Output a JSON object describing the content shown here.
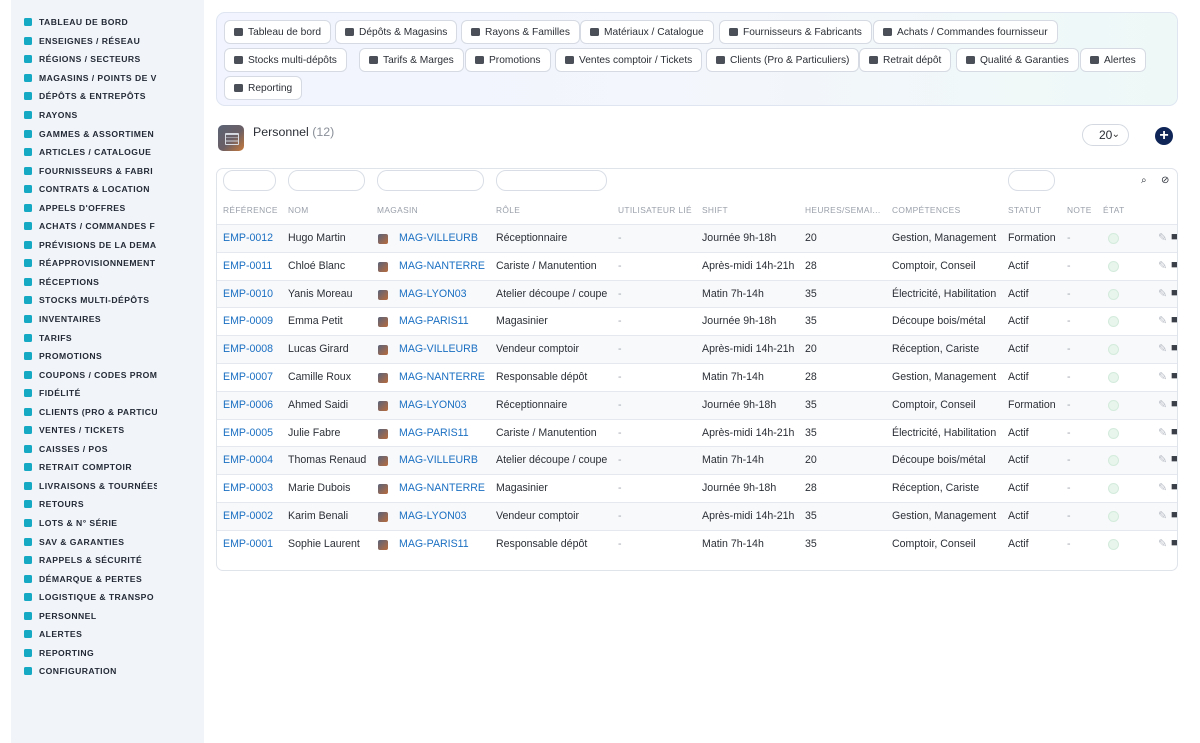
{
  "sidebar": {
    "items": [
      {
        "icon": "dashboard-icon",
        "label": "TABLEAU DE BORD"
      },
      {
        "icon": "flag-icon",
        "label": "ENSEIGNES / RÉSEAU"
      },
      {
        "icon": "map-icon",
        "label": "RÉGIONS / SECTEURS"
      },
      {
        "icon": "store-icon",
        "label": "MAGASINS / POINTS DE V"
      },
      {
        "icon": "warehouse-icon",
        "label": "DÉPÔTS & ENTREPÔTS"
      },
      {
        "icon": "shelf-icon",
        "label": "RAYONS"
      },
      {
        "icon": "layers-icon",
        "label": "GAMMES & ASSORTIMEN"
      },
      {
        "icon": "box-icon",
        "label": "ARTICLES / CATALOGUE"
      },
      {
        "icon": "truck-icon",
        "label": "FOURNISSEURS & FABRI"
      },
      {
        "icon": "contract-icon",
        "label": "CONTRATS & LOCATION"
      },
      {
        "icon": "gavel-icon",
        "label": "APPELS D'OFFRES"
      },
      {
        "icon": "cart-icon",
        "label": "ACHATS / COMMANDES F"
      },
      {
        "icon": "chart-icon",
        "label": "PRÉVISIONS DE LA DEMA"
      },
      {
        "icon": "refresh-icon",
        "label": "RÉAPPROVISIONNEMENT"
      },
      {
        "icon": "receive-icon",
        "label": "RÉCEPTIONS"
      },
      {
        "icon": "stock-icon",
        "label": "STOCKS MULTI-DÉPÔTS"
      },
      {
        "icon": "clipboard-icon",
        "label": "INVENTAIRES"
      },
      {
        "icon": "tag-icon",
        "label": "TARIFS"
      },
      {
        "icon": "percent-icon",
        "label": "PROMOTIONS"
      },
      {
        "icon": "coupon-icon",
        "label": "COUPONS / CODES PROM"
      },
      {
        "icon": "star-icon",
        "label": "FIDÉLITÉ"
      },
      {
        "icon": "user-icon",
        "label": "CLIENTS (PRO & PARTICU"
      },
      {
        "icon": "receipt-icon",
        "label": "VENTES / TICKETS"
      },
      {
        "icon": "register-icon",
        "label": "CAISSES / POS"
      },
      {
        "icon": "car-icon",
        "label": "RETRAIT COMPTOIR"
      },
      {
        "icon": "delivery-icon",
        "label": "LIVRAISONS & TOURNÉES"
      },
      {
        "icon": "return-icon",
        "label": "RETOURS"
      },
      {
        "icon": "barcode-icon",
        "label": "LOTS & N° SÉRIE"
      },
      {
        "icon": "tools-icon",
        "label": "SAV & GARANTIES"
      },
      {
        "icon": "warning-icon",
        "label": "RAPPELS & SÉCURITÉ"
      },
      {
        "icon": "trash-icon",
        "label": "DÉMARQUE & PERTES"
      },
      {
        "icon": "route-icon",
        "label": "LOGISTIQUE & TRANSPO"
      },
      {
        "icon": "people-icon",
        "label": "PERSONNEL"
      },
      {
        "icon": "bell-icon",
        "label": "ALERTES"
      },
      {
        "icon": "pie-icon",
        "label": "REPORTING"
      },
      {
        "icon": "gear-icon",
        "label": "CONFIGURATION"
      }
    ]
  },
  "nav": {
    "buttons": [
      {
        "icon": "dashboard-icon",
        "label": "Tableau de bord"
      },
      {
        "icon": "warehouse-icon",
        "label": "Dépôts & Magasins"
      },
      {
        "icon": "basket-icon",
        "label": "Rayons & Familles"
      },
      {
        "icon": "catalog-icon",
        "label": "Matériaux / Catalogue"
      },
      {
        "icon": "truck-icon",
        "label": "Fournisseurs & Fabricants"
      },
      {
        "icon": "cart-icon",
        "label": "Achats / Commandes fournisseur"
      },
      {
        "icon": "stock-icon",
        "label": "Stocks multi-dépôts"
      },
      {
        "icon": "tag-icon",
        "label": "Tarifs & Marges"
      },
      {
        "icon": "percent-icon",
        "label": "Promotions"
      },
      {
        "icon": "receipt-icon",
        "label": "Ventes comptoir / Tickets"
      },
      {
        "icon": "user-icon",
        "label": "Clients (Pro & Particuliers)"
      },
      {
        "icon": "car-icon",
        "label": "Retrait dépôt"
      },
      {
        "icon": "check-icon",
        "label": "Qualité & Garanties"
      },
      {
        "icon": "bell-icon",
        "label": "Alertes"
      },
      {
        "icon": "pie-icon",
        "label": "Reporting"
      }
    ]
  },
  "header": {
    "title": "Personnel",
    "count": "(12)",
    "page_size": "20"
  },
  "table": {
    "columns": [
      "RÉFÉRENCE",
      "NOM",
      "MAGASIN",
      "RÔLE",
      "UTILISATEUR LIÉ",
      "SHIFT",
      "HEURES/SEMAI...",
      "COMPÉTENCES",
      "STATUT",
      "NOTE",
      "ÉTAT"
    ],
    "rows": [
      {
        "ref": "EMP-0012",
        "nom": "Hugo Martin",
        "magasin": "MAG-VILLEURB",
        "role": "Réceptionnaire",
        "user": "-",
        "shift": "Journée 9h-18h",
        "heures": "20",
        "competences": "Gestion, Management",
        "statut": "Formation",
        "note": "-"
      },
      {
        "ref": "EMP-0011",
        "nom": "Chloé Blanc",
        "magasin": "MAG-NANTERRE",
        "role": "Cariste / Manutention",
        "user": "-",
        "shift": "Après-midi 14h-21h",
        "heures": "28",
        "competences": "Comptoir, Conseil",
        "statut": "Actif",
        "note": "-"
      },
      {
        "ref": "EMP-0010",
        "nom": "Yanis Moreau",
        "magasin": "MAG-LYON03",
        "role": "Atelier découpe / coupe",
        "user": "-",
        "shift": "Matin 7h-14h",
        "heures": "35",
        "competences": "Électricité, Habilitation",
        "statut": "Actif",
        "note": "-"
      },
      {
        "ref": "EMP-0009",
        "nom": "Emma Petit",
        "magasin": "MAG-PARIS11",
        "role": "Magasinier",
        "user": "-",
        "shift": "Journée 9h-18h",
        "heures": "35",
        "competences": "Découpe bois/métal",
        "statut": "Actif",
        "note": "-"
      },
      {
        "ref": "EMP-0008",
        "nom": "Lucas Girard",
        "magasin": "MAG-VILLEURB",
        "role": "Vendeur comptoir",
        "user": "-",
        "shift": "Après-midi 14h-21h",
        "heures": "20",
        "competences": "Réception, Cariste",
        "statut": "Actif",
        "note": "-"
      },
      {
        "ref": "EMP-0007",
        "nom": "Camille Roux",
        "magasin": "MAG-NANTERRE",
        "role": "Responsable dépôt",
        "user": "-",
        "shift": "Matin 7h-14h",
        "heures": "28",
        "competences": "Gestion, Management",
        "statut": "Actif",
        "note": "-"
      },
      {
        "ref": "EMP-0006",
        "nom": "Ahmed Saidi",
        "magasin": "MAG-LYON03",
        "role": "Réceptionnaire",
        "user": "-",
        "shift": "Journée 9h-18h",
        "heures": "35",
        "competences": "Comptoir, Conseil",
        "statut": "Formation",
        "note": "-"
      },
      {
        "ref": "EMP-0005",
        "nom": "Julie Fabre",
        "magasin": "MAG-PARIS11",
        "role": "Cariste / Manutention",
        "user": "-",
        "shift": "Après-midi 14h-21h",
        "heures": "35",
        "competences": "Électricité, Habilitation",
        "statut": "Actif",
        "note": "-"
      },
      {
        "ref": "EMP-0004",
        "nom": "Thomas Renaud",
        "magasin": "MAG-VILLEURB",
        "role": "Atelier découpe / coupe",
        "user": "-",
        "shift": "Matin 7h-14h",
        "heures": "20",
        "competences": "Découpe bois/métal",
        "statut": "Actif",
        "note": "-"
      },
      {
        "ref": "EMP-0003",
        "nom": "Marie Dubois",
        "magasin": "MAG-NANTERRE",
        "role": "Magasinier",
        "user": "-",
        "shift": "Journée 9h-18h",
        "heures": "28",
        "competences": "Réception, Cariste",
        "statut": "Actif",
        "note": "-"
      },
      {
        "ref": "EMP-0002",
        "nom": "Karim Benali",
        "magasin": "MAG-LYON03",
        "role": "Vendeur comptoir",
        "user": "-",
        "shift": "Après-midi 14h-21h",
        "heures": "35",
        "competences": "Gestion, Management",
        "statut": "Actif",
        "note": "-"
      },
      {
        "ref": "EMP-0001",
        "nom": "Sophie Laurent",
        "magasin": "MAG-PARIS11",
        "role": "Responsable dépôt",
        "user": "-",
        "shift": "Matin 7h-14h",
        "heures": "35",
        "competences": "Comptoir, Conseil",
        "statut": "Actif",
        "note": "-"
      }
    ]
  },
  "colors": {
    "accent": "#16a9c4",
    "link": "#1a6fc2",
    "add_button": "#0f2557"
  }
}
